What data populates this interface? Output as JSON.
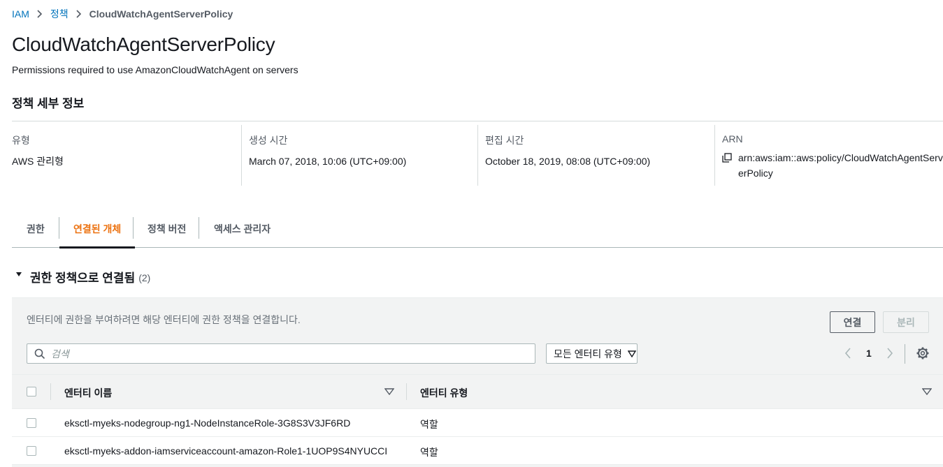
{
  "breadcrumb": {
    "items": [
      "IAM",
      "정책"
    ],
    "current": "CloudWatchAgentServerPolicy"
  },
  "page": {
    "title": "CloudWatchAgentServerPolicy",
    "description": "Permissions required to use AmazonCloudWatchAgent on servers"
  },
  "details": {
    "section_title": "정책 세부 정보",
    "type_label": "유형",
    "type_value": "AWS 관리형",
    "created_label": "생성 시간",
    "created_value": "March 07, 2018, 10:06 (UTC+09:00)",
    "edited_label": "편집 시간",
    "edited_value": "October 18, 2019, 08:08 (UTC+09:00)",
    "arn_label": "ARN",
    "arn_value": "arn:aws:iam::aws:policy/CloudWatchAgentServerPolicy"
  },
  "tabs": [
    {
      "label": "권한",
      "active": false
    },
    {
      "label": "연결된 개체",
      "active": true
    },
    {
      "label": "정책 버전",
      "active": false
    },
    {
      "label": "액세스 관리자",
      "active": false
    }
  ],
  "attached": {
    "title": "권한 정책으로 연결됨",
    "count": "(2)",
    "description": "엔터티에 권한을 부여하려면 해당 엔터티에 권한 정책을 연결합니다.",
    "attach_button": "연결",
    "detach_button": "분리",
    "search_placeholder": "검색",
    "filter_selected": "모든 엔터티 유형",
    "page_number": "1",
    "columns": [
      "엔터티 이름",
      "엔터티 유형"
    ],
    "rows": [
      {
        "name": "eksctl-myeks-nodegroup-ng1-NodeInstanceRole-3G8S3V3JF6RD",
        "type": "역할"
      },
      {
        "name": "eksctl-myeks-addon-iamserviceaccount-amazon-Role1-1UOP9S4NYUCCI",
        "type": "역할"
      }
    ]
  },
  "colors": {
    "link": "#0073bb",
    "active_tab": "#ec7211",
    "panel_bg": "#f2f3f3",
    "border": "#aab7b8"
  }
}
